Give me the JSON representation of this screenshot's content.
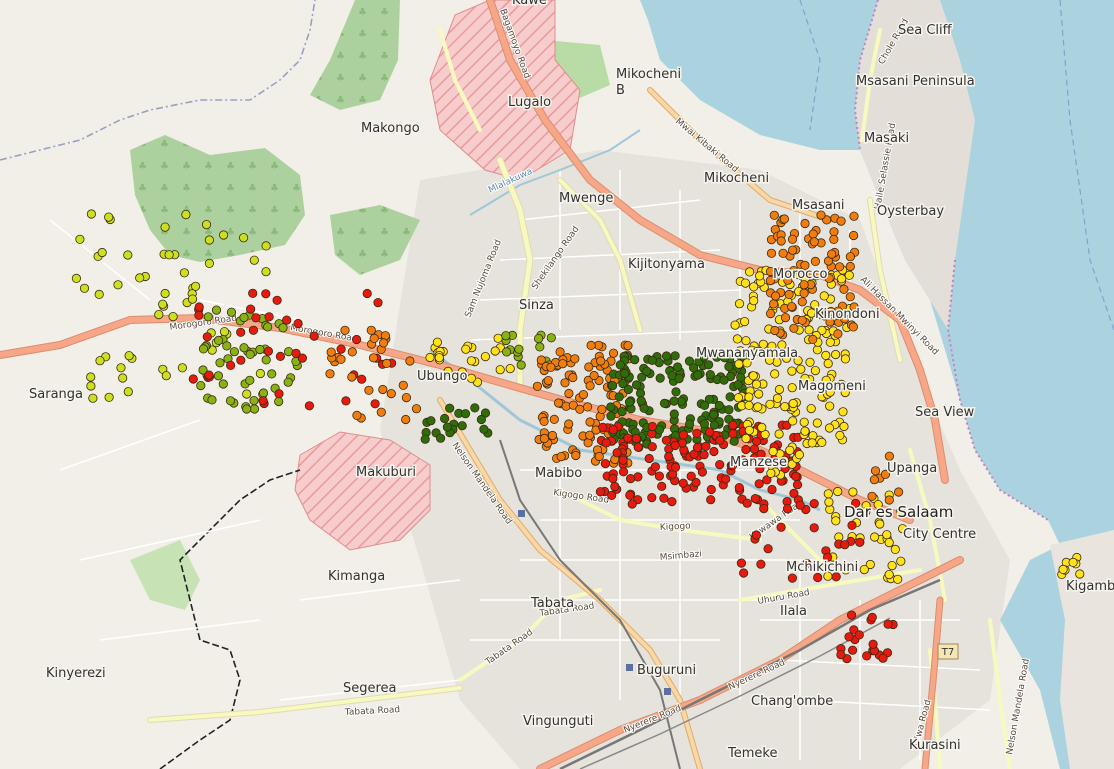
{
  "map": {
    "places": [
      {
        "id": "kawe",
        "label": "Kawe"
      },
      {
        "id": "sea-cliff",
        "label": "Sea Cliff"
      },
      {
        "id": "mikocheni-b",
        "label": "Mikocheni\nB"
      },
      {
        "id": "msasani-peninsula",
        "label": "Msasani Peninsula"
      },
      {
        "id": "lugalo",
        "label": "Lugalo"
      },
      {
        "id": "makongo",
        "label": "Makongo"
      },
      {
        "id": "masaki",
        "label": "Masaki"
      },
      {
        "id": "mikocheni",
        "label": "Mikocheni"
      },
      {
        "id": "mwenge",
        "label": "Mwenge"
      },
      {
        "id": "msasani",
        "label": "Msasani"
      },
      {
        "id": "oysterbay",
        "label": "Oysterbay"
      },
      {
        "id": "kijitonyama",
        "label": "Kijitonyama"
      },
      {
        "id": "sinza",
        "label": "Sinza"
      },
      {
        "id": "ubungo",
        "label": "Ubungo"
      },
      {
        "id": "saranga",
        "label": "Saranga"
      },
      {
        "id": "sea-view",
        "label": "Sea View"
      },
      {
        "id": "makuburi",
        "label": "Makuburi"
      },
      {
        "id": "mabibo",
        "label": "Mabibo"
      },
      {
        "id": "upanga",
        "label": "Upanga"
      },
      {
        "id": "dar-es-salaam",
        "label": "Dar es Salaam"
      },
      {
        "id": "city-centre",
        "label": "City Centre"
      },
      {
        "id": "kimanga",
        "label": "Kimanga"
      },
      {
        "id": "mchikichini",
        "label": "Mchikichini"
      },
      {
        "id": "tabata",
        "label": "Tabata"
      },
      {
        "id": "ilala",
        "label": "Ilala"
      },
      {
        "id": "kigamboni",
        "label": "Kigamboni"
      },
      {
        "id": "kinyerezi",
        "label": "Kinyerezi"
      },
      {
        "id": "segerea",
        "label": "Segerea"
      },
      {
        "id": "buguruni",
        "label": "Buguruni"
      },
      {
        "id": "changombe",
        "label": "Chang'ombe"
      },
      {
        "id": "vingunguti",
        "label": "Vingunguti"
      },
      {
        "id": "temeke",
        "label": "Temeke"
      },
      {
        "id": "kurasini",
        "label": "Kurasini"
      },
      {
        "id": "mwananyamala",
        "label": "Mwananyamala"
      },
      {
        "id": "kinondoni",
        "label": "Kinondoni"
      },
      {
        "id": "magomeni",
        "label": "Magomeni"
      },
      {
        "id": "morocco",
        "label": "Morocco"
      },
      {
        "id": "manzese",
        "label": "Manzese"
      }
    ],
    "roads": [
      {
        "id": "bagamoyo",
        "label": "Bagamoyo Road"
      },
      {
        "id": "mwai-kibaki",
        "label": "Mwai Kibaki Road"
      },
      {
        "id": "chole",
        "label": "Chole Road"
      },
      {
        "id": "haile-selassie",
        "label": "Haile Selassie Road"
      },
      {
        "id": "ali-hassan-mwinyi",
        "label": "Ali Hassan Mwinyi Road"
      },
      {
        "id": "shekilango",
        "label": "Shekilango Road"
      },
      {
        "id": "sam-nujoma",
        "label": "Sam Nujoma Road"
      },
      {
        "id": "morogoro-1",
        "label": "Morogoro Road"
      },
      {
        "id": "morogoro-2",
        "label": "Morogoro Road"
      },
      {
        "id": "nelson-mandela",
        "label": "Nelson Mandela Road"
      },
      {
        "id": "kigogo-road",
        "label": "Kigogo Road"
      },
      {
        "id": "kigogo",
        "label": "Kigogo"
      },
      {
        "id": "msimbazi",
        "label": "Msimbazi"
      },
      {
        "id": "kawawa",
        "label": "Kawawa Road"
      },
      {
        "id": "uhuru",
        "label": "Uhuru Road"
      },
      {
        "id": "tabata-road-1",
        "label": "Tabata Road"
      },
      {
        "id": "tabata-road-2",
        "label": "Tabata Road"
      },
      {
        "id": "tabata-road-3",
        "label": "Tabata Road"
      },
      {
        "id": "nyerere-1",
        "label": "Nyerere Road"
      },
      {
        "id": "nyerere-2",
        "label": "Nyerere Road"
      },
      {
        "id": "kilwa",
        "label": "Kilwa Road"
      },
      {
        "id": "nelson-mandela-2",
        "label": "Nelson Mandela Road"
      },
      {
        "id": "mlalakuwa",
        "label": "Mlalakuwa"
      }
    ],
    "shield": "T7",
    "colors": {
      "background": "#f2efe9",
      "water": "#aad3df",
      "forest": "#add19e",
      "restricted": "#f2b6b6",
      "trunk": "#f7a787",
      "secondary": "#f7fabf",
      "tertiary": "#ffffff",
      "red": "#e8190f",
      "orange": "#f07d0e",
      "yellow": "#ffe21a",
      "yellow_green": "#cde01f",
      "olive": "#88b312",
      "dark_green": "#2f6d0b"
    },
    "point_categories": [
      "red",
      "orange",
      "yellow",
      "yellow_green",
      "olive",
      "dark_green"
    ]
  }
}
